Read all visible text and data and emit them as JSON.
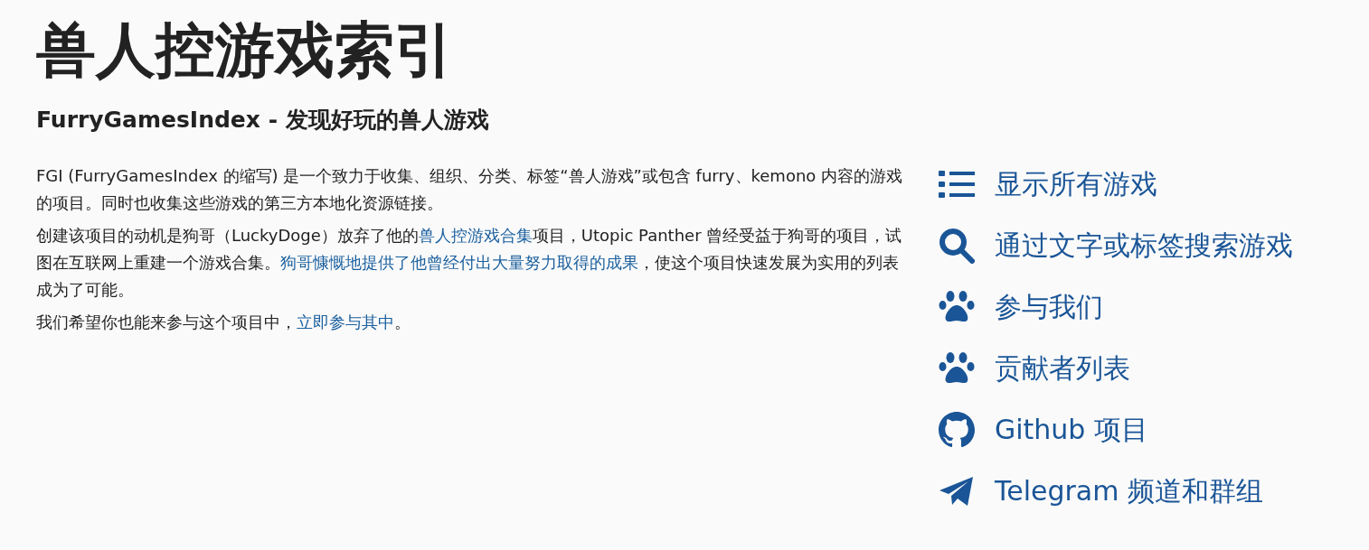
{
  "title": "兽人控游戏索引",
  "subtitle": "FurryGamesIndex - 发现好玩的兽人游戏",
  "paragraphs": [
    [
      {
        "kind": "text",
        "text": "FGI (FurryGamesIndex 的缩写) 是一个致力于收集、组织、分类、标签“兽人游戏”或包含 furry、kemono 内容的游戏的项目。同时也收集这些游戏的第三方本地化资源链接。"
      }
    ],
    [
      {
        "kind": "text",
        "text": "创建该项目的动机是狗哥（LuckyDoge）放弃了他的"
      },
      {
        "kind": "link",
        "text": "兽人控游戏合集"
      },
      {
        "kind": "text",
        "text": "项目，Utopic Panther 曾经受益于狗哥的项目，试图在互联网上重建一个游戏合集。"
      },
      {
        "kind": "link",
        "text": "狗哥慷慨地提供了他曾经付出大量努力取得的成果"
      },
      {
        "kind": "text",
        "text": "，使这个项目快速发展为实用的列表成为了可能。"
      }
    ],
    [
      {
        "kind": "text",
        "text": "我们希望你也能来参与这个项目中，"
      },
      {
        "kind": "link",
        "text": "立即参与其中"
      },
      {
        "kind": "text",
        "text": "。"
      }
    ]
  ],
  "nav": [
    {
      "kind": "list",
      "label": "显示所有游戏"
    },
    {
      "kind": "search",
      "label": "通过文字或标签搜索游戏"
    },
    {
      "kind": "paw",
      "label": "参与我们"
    },
    {
      "kind": "paw",
      "label": "贡献者列表"
    },
    {
      "kind": "github",
      "label": "Github 项目"
    },
    {
      "kind": "telegram",
      "label": "Telegram 频道和群组"
    }
  ]
}
